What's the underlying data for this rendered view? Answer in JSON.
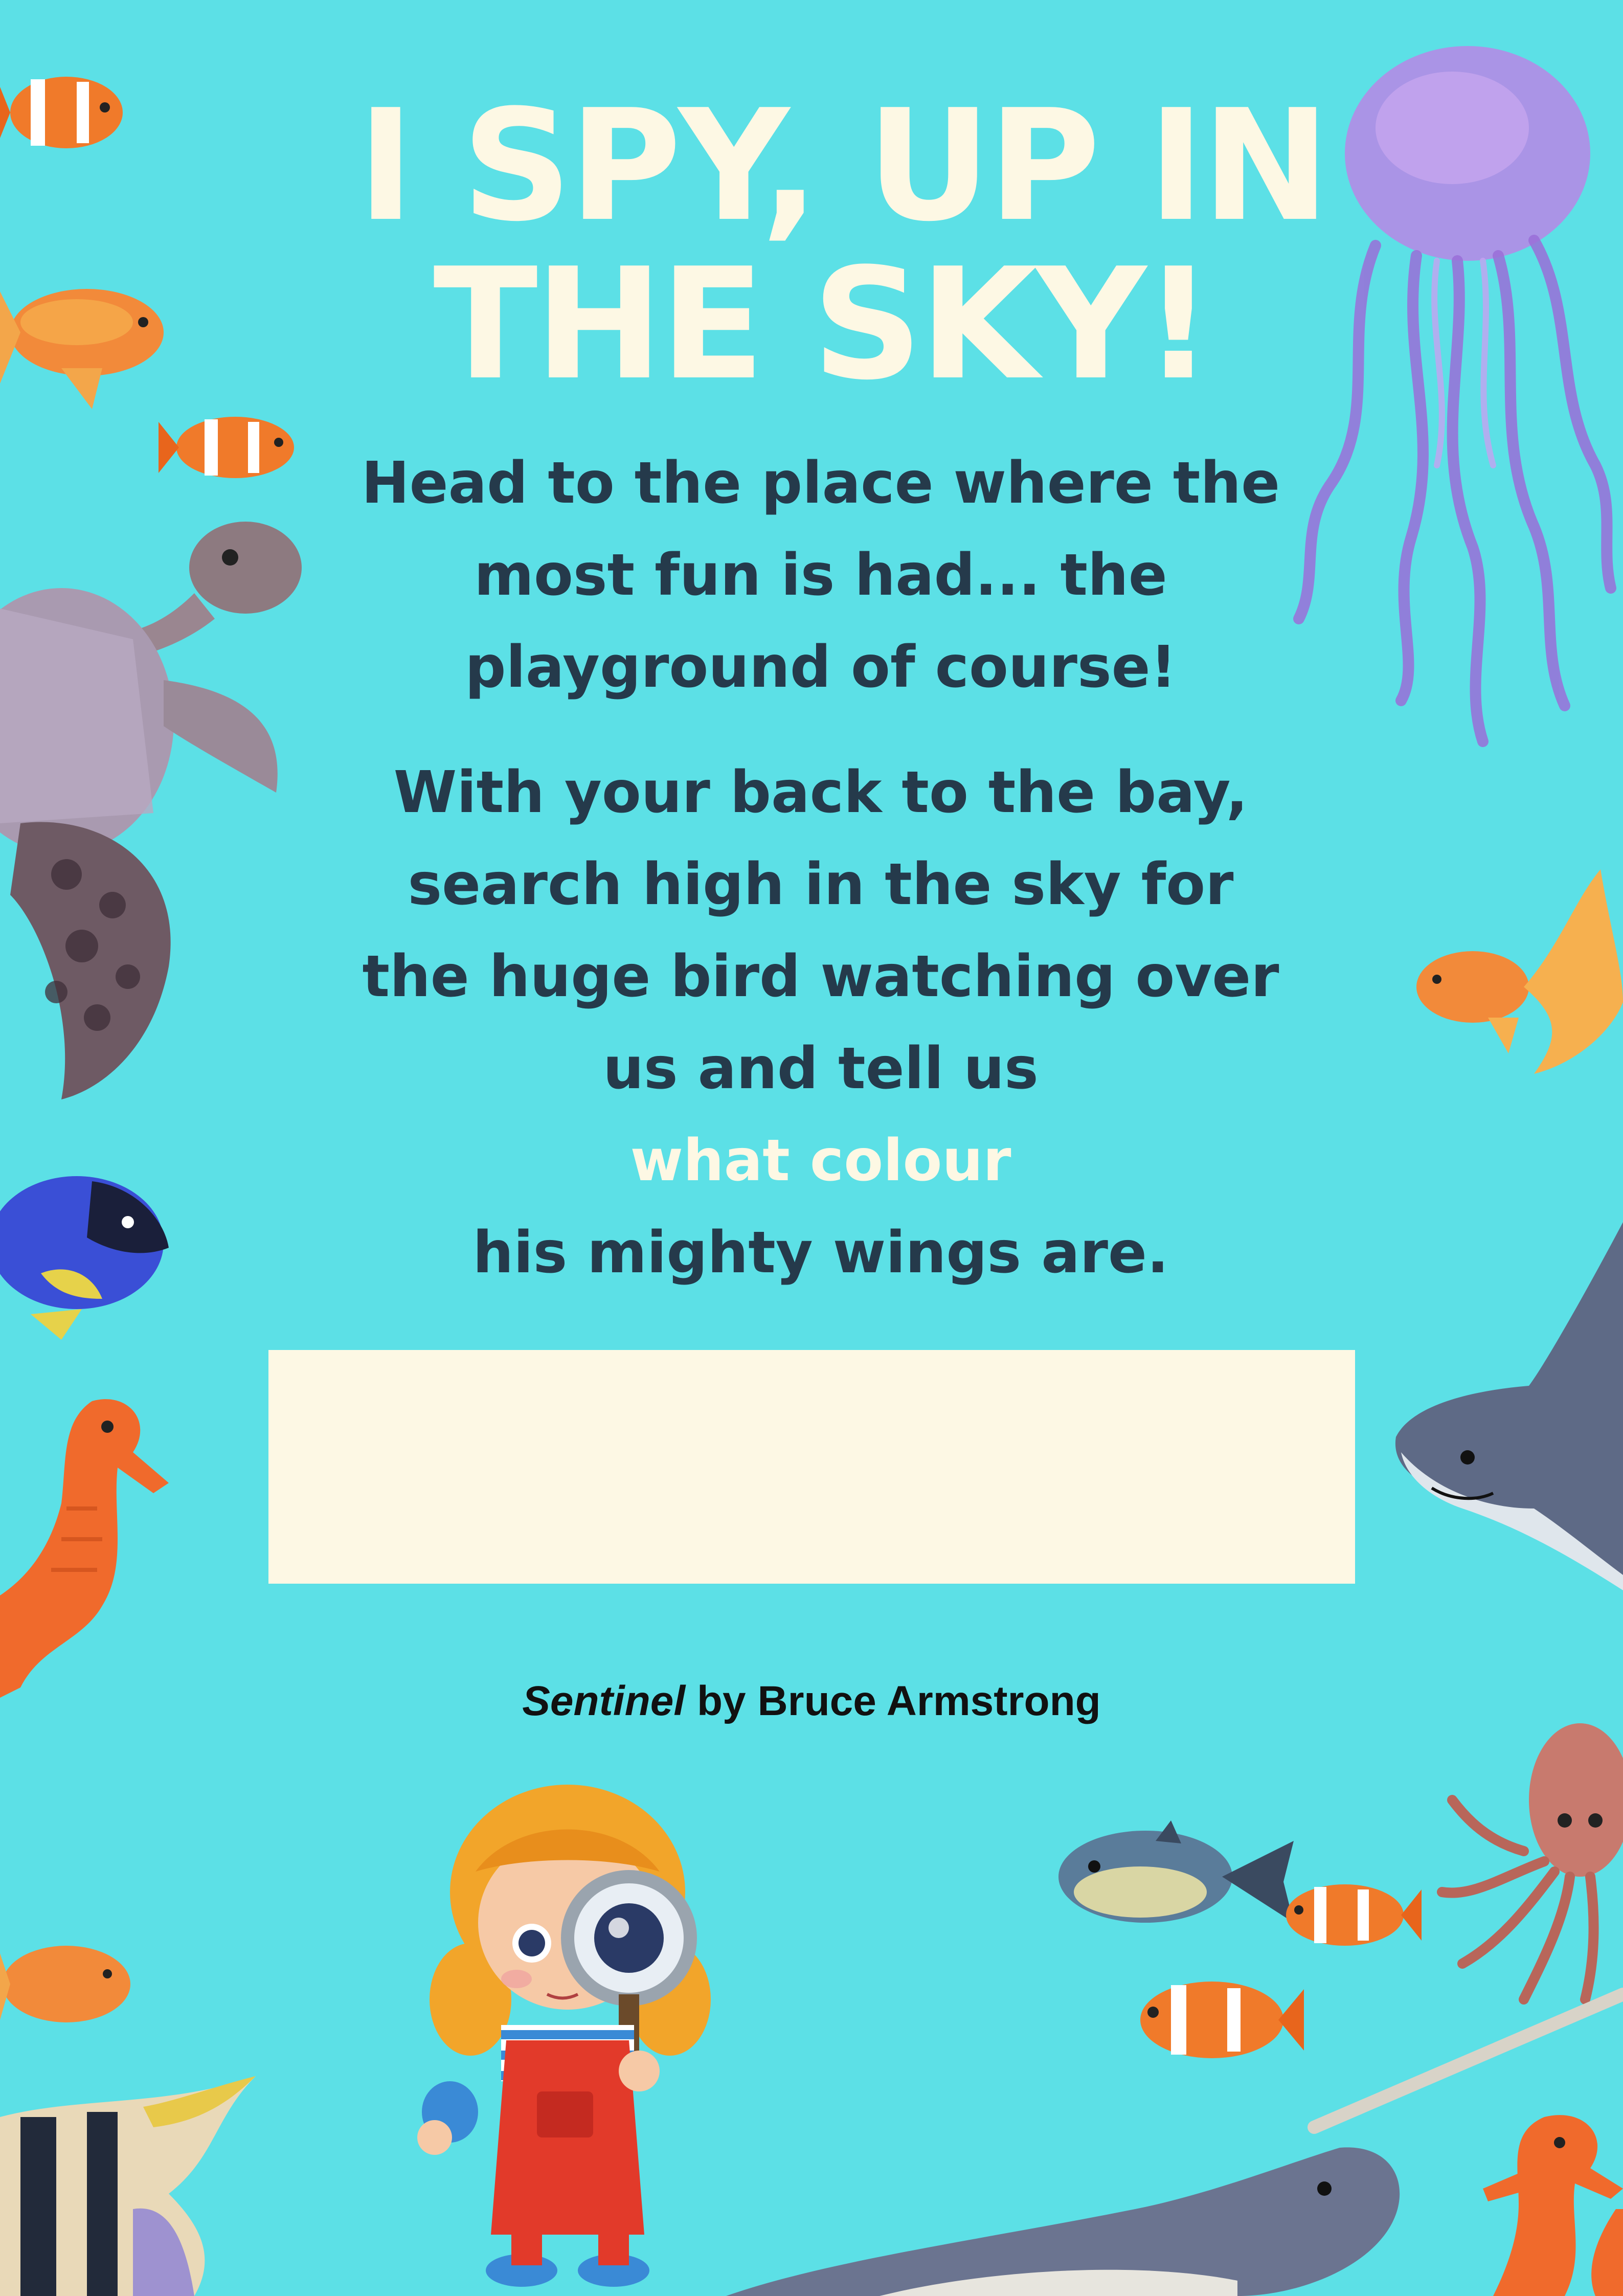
{
  "title": {
    "line1": "I SPY, UP IN",
    "line2": "THE SKY!"
  },
  "clue": {
    "paragraph1": [
      "Head to the place where the",
      "most fun is had... the",
      "playground of course!"
    ],
    "paragraph2": [
      "With your back to the bay,",
      "search high in the sky for",
      "the huge bird watching over",
      "us and tell us"
    ],
    "highlight": "what colour",
    "paragraph2_end": "his mighty wings are."
  },
  "answer_box": {
    "value": ""
  },
  "credit": {
    "work": "Sentinel",
    "by": " by Bruce Armstrong"
  },
  "colors": {
    "background": "#5ce0e6",
    "title": "#fdf8e4",
    "body_text": "#253a4b",
    "highlight": "#fdf8e4",
    "answer_box": "#fdf8e4"
  },
  "illustrations": [
    "clownfish-icon",
    "goldfish-icon",
    "sea-turtle-icon",
    "blue-tang-icon",
    "seahorse-icon",
    "angelfish-icon",
    "jellyfish-icon",
    "manta-ray-icon",
    "squid-icon",
    "narwhal-icon",
    "pufferfish-icon",
    "girl-with-magnifier-icon"
  ]
}
